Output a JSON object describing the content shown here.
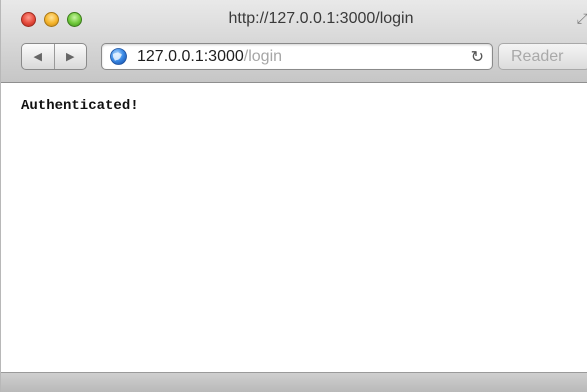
{
  "window": {
    "title": "http://127.0.0.1:3000/login"
  },
  "toolbar": {
    "back_icon": "◀",
    "forward_icon": "▶",
    "url_host": "127.0.0.1:3000",
    "url_path": "/login",
    "reload_icon": "↻",
    "reader_label": "Reader",
    "fullscreen_icon": "⤢"
  },
  "page": {
    "message": "Authenticated!"
  },
  "icons": {
    "globe": "globe-icon",
    "reload": "reload-icon",
    "back": "back-arrow-icon",
    "forward": "forward-arrow-icon",
    "fullscreen": "fullscreen-icon"
  },
  "colors": {
    "close": "#e54a3c",
    "minimize": "#f5b42a",
    "zoom": "#6fc93a",
    "url_path": "#a6a6a6"
  }
}
